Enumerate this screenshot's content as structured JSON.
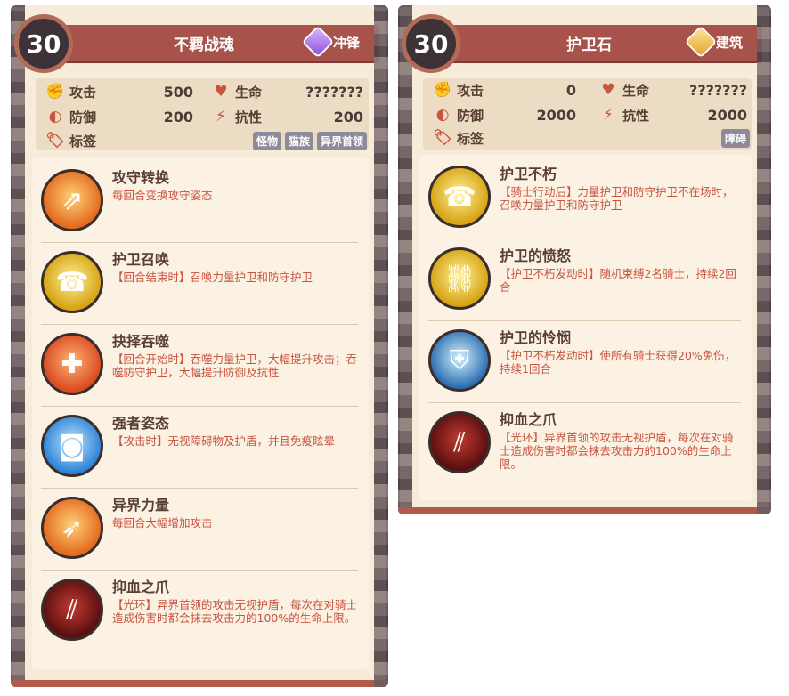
{
  "cards": [
    {
      "level": "30",
      "name": "不羁战魂",
      "class_label": "冲锋",
      "class_icon": "charge-class-icon",
      "stats": {
        "attack_label": "攻击",
        "attack_value": "500",
        "life_label": "生命",
        "life_value": "???????",
        "defense_label": "防御",
        "defense_value": "200",
        "resist_label": "抗性",
        "resist_value": "200",
        "tag_label": "标签",
        "tags": [
          "怪物",
          "猫族",
          "异界首领"
        ]
      },
      "skills": [
        {
          "name": "攻守转换",
          "desc": "每回合变换攻守姿态",
          "icon": "arrows-burst-icon"
        },
        {
          "name": "护卫召唤",
          "desc": "【回合结束时】召唤力量护卫和防守护卫",
          "icon": "phone-horn-icon"
        },
        {
          "name": "抉择吞噬",
          "desc": "【回合开始时】吞噬力量护卫，大幅提升攻击；吞噬防守护卫，大幅提升防御及抗性",
          "icon": "heart-plus-icon"
        },
        {
          "name": "强者姿态",
          "desc": "【攻击时】无视障碍物及护盾，并且免疫眩晕",
          "icon": "sunglasses-icon"
        },
        {
          "name": "异界力量",
          "desc": "每回合大幅增加攻击",
          "icon": "power-arrow-icon"
        },
        {
          "name": "抑血之爪",
          "desc": "【光环】异界首领的攻击无视护盾，每次在对骑士造成伤害时都会抹去攻击力的100%的生命上限。",
          "icon": "claw-slash-icon"
        }
      ]
    },
    {
      "level": "30",
      "name": "护卫石",
      "class_label": "建筑",
      "class_icon": "building-class-icon",
      "stats": {
        "attack_label": "攻击",
        "attack_value": "0",
        "life_label": "生命",
        "life_value": "???????",
        "defense_label": "防御",
        "defense_value": "2000",
        "resist_label": "抗性",
        "resist_value": "2000",
        "tag_label": "标签",
        "tags": [
          "障碍"
        ]
      },
      "skills": [
        {
          "name": "护卫不朽",
          "desc": "【骑士行动后】力量护卫和防守护卫不在场时，召唤力量护卫和防守护卫",
          "icon": "phone-horn-icon"
        },
        {
          "name": "护卫的愤怒",
          "desc": "【护卫不朽发动时】随机束缚2名骑士，持续2回合",
          "icon": "chain-icon"
        },
        {
          "name": "护卫的怜悯",
          "desc": "【护卫不朽发动时】使所有骑士获得20%免伤，持续1回合",
          "icon": "armor-icon"
        },
        {
          "name": "抑血之爪",
          "desc": "【光环】异界首领的攻击无视护盾，每次在对骑士造成伤害时都会抹去攻击力的100%的生命上限。",
          "icon": "claw-slash-icon"
        }
      ]
    }
  ]
}
